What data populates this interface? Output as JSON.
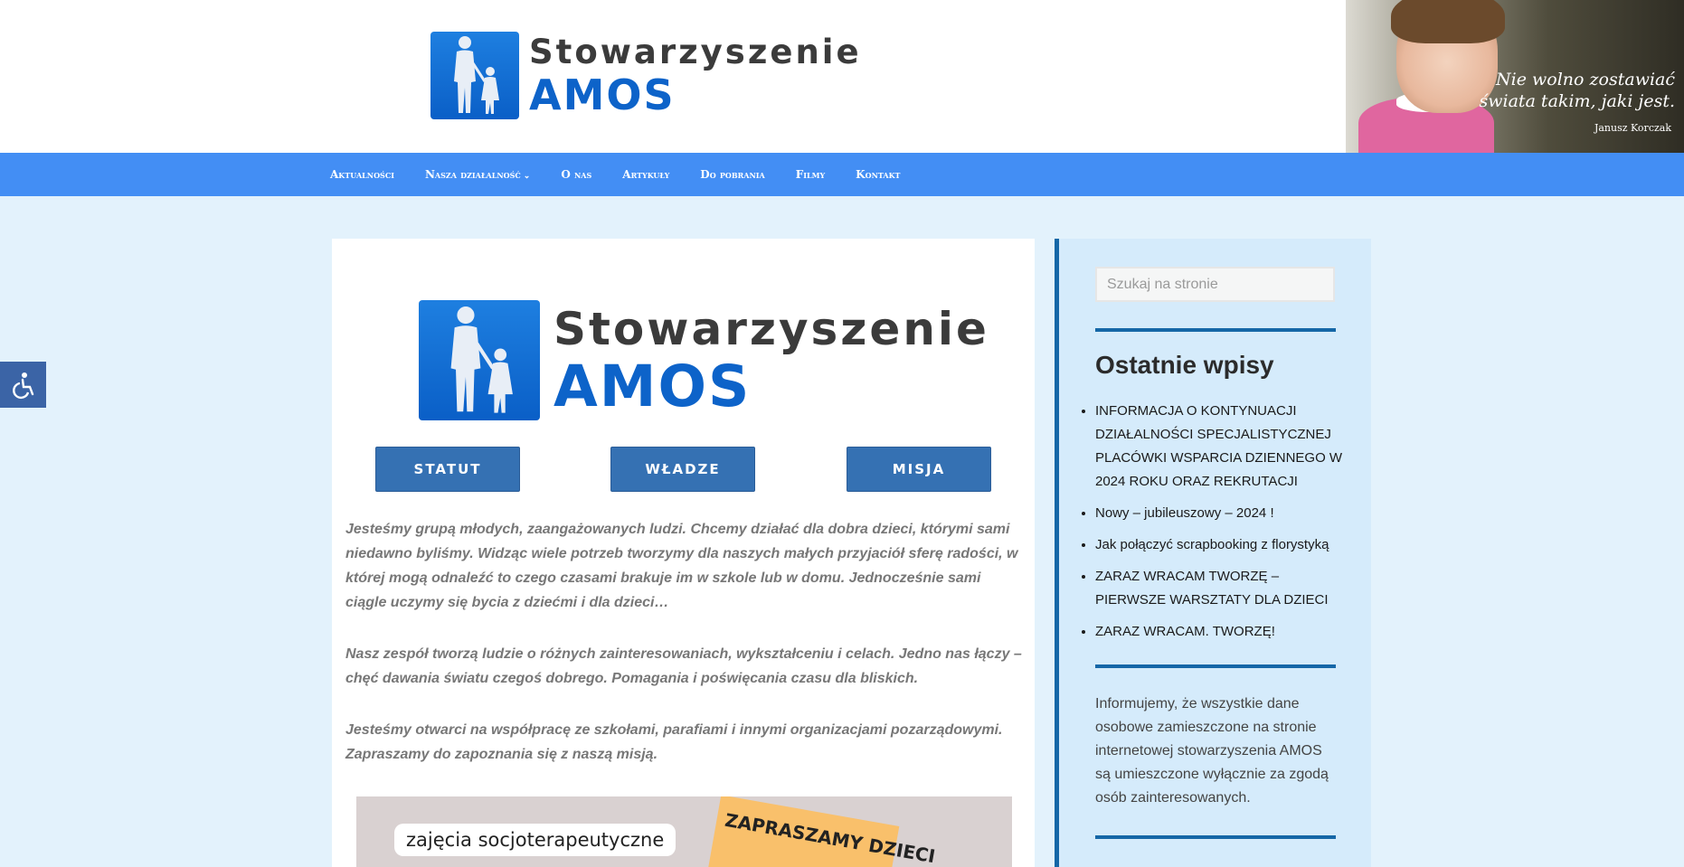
{
  "header": {
    "logo": {
      "line1": "Stowarzyszenie",
      "line2": "AMOS"
    },
    "hero": {
      "quote_line1": "Nie wolno zostawiać",
      "quote_line2": "świata takim, jaki jest.",
      "author": "Janusz Korczak"
    }
  },
  "nav": {
    "items": [
      {
        "label": "Aktualności"
      },
      {
        "label": "Nasza działalność",
        "has_dropdown": true
      },
      {
        "label": "O nas"
      },
      {
        "label": "Artykuły"
      },
      {
        "label": "Do pobrania"
      },
      {
        "label": "Filmy"
      },
      {
        "label": "Kontakt"
      }
    ],
    "dropdown_icon": "chevron-down-icon"
  },
  "accessibility": {
    "icon": "wheelchair-icon"
  },
  "main": {
    "logo": {
      "line1": "Stowarzyszenie",
      "line2": "AMOS"
    },
    "buttons": [
      "STATUT",
      "WŁADZE",
      "MISJA"
    ],
    "paragraphs": [
      "Jesteśmy grupą młodych, zaangażowanych ludzi. Chcemy działać dla dobra dzieci, którymi sami niedawno byliśmy. Widząc wiele potrzeb tworzymy dla naszych małych przyjaciół sferę radości, w której mogą odnaleźć to czego czasami brakuje im w szkole lub w domu. Jednocześnie sami ciągle uczymy się bycia z dziećmi i dla dzieci…",
      "Nasz zespół tworzą ludzie o różnych zainteresowaniach, wykształceniu i celach. Jedno nas łączy – chęć dawania światu czegoś dobrego. Pomagania i poświęcania czasu dla bliskich.",
      "Jesteśmy otwarci na współpracę ze szkołami, parafiami i innymi organizacjami pozarządowymi. Zapraszamy do zapoznania się z naszą misją."
    ],
    "poster": {
      "label1": "zajęcia socjoterapeutyczne",
      "label2": "ZAPRASZAMY DZIECI"
    }
  },
  "sidebar": {
    "search_placeholder": "Szukaj na stronie",
    "recent_title": "Ostatnie wpisy",
    "recent_posts": [
      "INFORMACJA O KONTYNUACJI DZIAŁALNOŚCI SPECJALISTYCZNEJ PLACÓWKI WSPARCIA DZIENNEGO W 2024  ROKU ORAZ REKRUTACJI",
      "Nowy – jubileuszowy – 2024 !",
      "Jak połączyć scrapbooking z florystyką",
      "ZARAZ WRACAM TWORZĘ – PIERWSZE WARSZTATY DLA DZIECI",
      "ZARAZ WRACAM. TWORZĘ!"
    ],
    "notice": "Informujemy, że wszystkie dane osobowe zamieszczone na stronie internetowej stowarzyszenia AMOS są umieszczone wyłącznie za zgodą osób zainteresowanych."
  },
  "colors": {
    "nav_bg": "#438ef4",
    "page_bg": "#e3f2fc",
    "button_bg": "#3571b3",
    "sidebar_bg": "#d5ebfb",
    "sidebar_accent": "#1567a7",
    "logo_blue": "#0d63c9"
  }
}
